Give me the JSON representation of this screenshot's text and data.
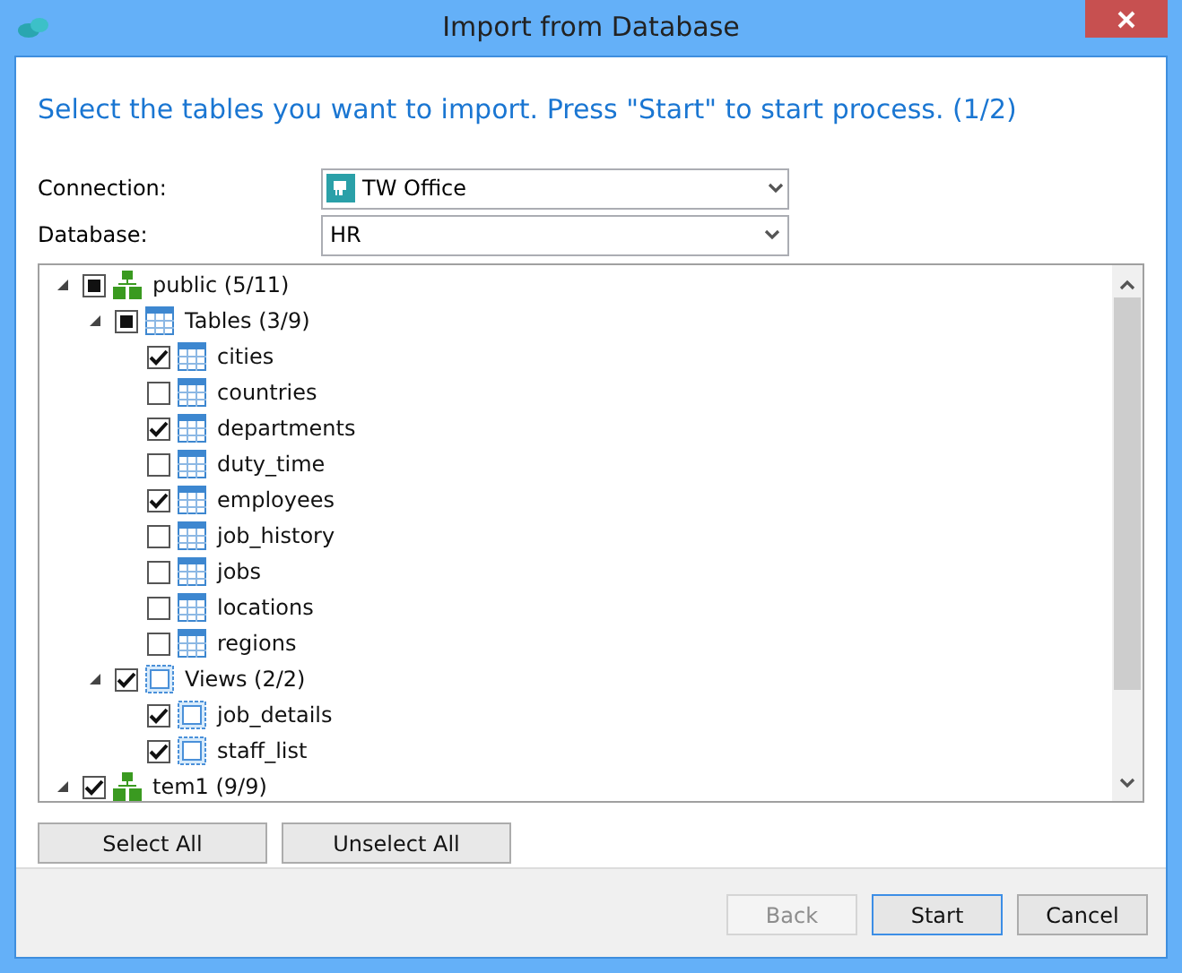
{
  "window": {
    "title": "Import from Database"
  },
  "instruction": "Select the tables you want to import. Press \"Start\" to start process. (1/2)",
  "connection": {
    "label": "Connection:",
    "value": "TW Office"
  },
  "database": {
    "label": "Database:",
    "value": "HR"
  },
  "tree": [
    {
      "label": "public (5/11)",
      "kind": "schema",
      "checked": false,
      "indeterminate": true,
      "expanded": true,
      "children": [
        {
          "label": "Tables (3/9)",
          "kind": "tables",
          "checked": false,
          "indeterminate": true,
          "expanded": true,
          "children": [
            {
              "label": "cities",
              "kind": "table",
              "checked": true,
              "indeterminate": false
            },
            {
              "label": "countries",
              "kind": "table",
              "checked": false,
              "indeterminate": false
            },
            {
              "label": "departments",
              "kind": "table",
              "checked": true,
              "indeterminate": false
            },
            {
              "label": "duty_time",
              "kind": "table",
              "checked": false,
              "indeterminate": false
            },
            {
              "label": "employees",
              "kind": "table",
              "checked": true,
              "indeterminate": false
            },
            {
              "label": "job_history",
              "kind": "table",
              "checked": false,
              "indeterminate": false
            },
            {
              "label": "jobs",
              "kind": "table",
              "checked": false,
              "indeterminate": false
            },
            {
              "label": "locations",
              "kind": "table",
              "checked": false,
              "indeterminate": false
            },
            {
              "label": "regions",
              "kind": "table",
              "checked": false,
              "indeterminate": false
            }
          ]
        },
        {
          "label": "Views (2/2)",
          "kind": "views",
          "checked": true,
          "indeterminate": false,
          "expanded": true,
          "children": [
            {
              "label": "job_details",
              "kind": "view",
              "checked": true,
              "indeterminate": false
            },
            {
              "label": "staff_list",
              "kind": "view",
              "checked": true,
              "indeterminate": false
            }
          ]
        }
      ]
    },
    {
      "label": "tem1 (9/9)",
      "kind": "schema",
      "checked": true,
      "indeterminate": false,
      "expanded": true
    }
  ],
  "selection_buttons": [
    "Select All",
    "Unselect All"
  ],
  "footer_buttons": [
    {
      "label": "Back",
      "disabled": true,
      "default": false
    },
    {
      "label": "Start",
      "disabled": false,
      "default": true
    },
    {
      "label": "Cancel",
      "disabled": false,
      "default": false
    }
  ]
}
